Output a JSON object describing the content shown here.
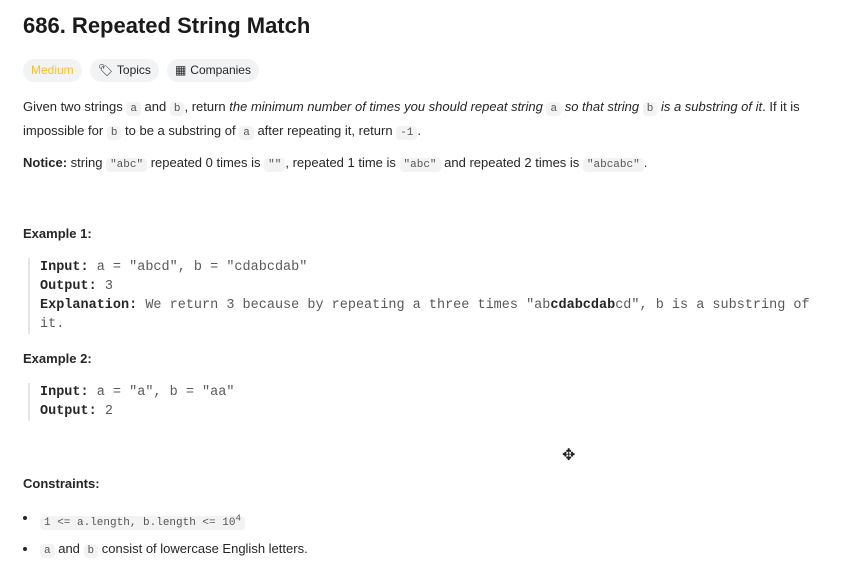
{
  "title": "686. Repeated String Match",
  "tags": {
    "difficulty": "Medium",
    "topics": "Topics",
    "companies": "Companies",
    "difficulty_color": "#ffc01e"
  },
  "desc": {
    "p1a": "Given two strings ",
    "a": "a",
    "and": " and ",
    "b": "b",
    "p1b": ", return ",
    "p1i": "the minimum number of times you should repeat string ",
    "p1j": " so that string ",
    "p1k": " is a substring of it",
    "p2a": ". If it is impossible for ",
    "p2b": " to be a substring of ",
    "p2c": " after repeating it, return ",
    "neg": "-1",
    "dot": "."
  },
  "notice": {
    "label": "Notice:",
    "t1": " string ",
    "c1": "\"abc\"",
    "t2": " repeated 0 times is ",
    "c2": "\"\"",
    "t3": ", repeated 1 time is ",
    "c3": "\"abc\"",
    "t4": " and repeated 2 times is ",
    "c4": "\"abcabc\"",
    "t5": "."
  },
  "example1": {
    "heading": "Example 1:",
    "input_label": "Input:",
    "input": " a = \"abcd\", b = \"cdabcdab\"",
    "output_label": "Output:",
    "output": " 3",
    "expl_label": "Explanation:",
    "expl_a": " We return 3 because by repeating a three times \"ab",
    "expl_b": "cdabcdab",
    "expl_c": "cd\", b is a substring of it."
  },
  "example2": {
    "heading": "Example 2:",
    "input_label": "Input:",
    "input": " a = \"a\", b = \"aa\"",
    "output_label": "Output:",
    "output": " 2"
  },
  "constraints": {
    "heading": "Constraints:",
    "c1": "1 <= a.length, b.length <= 10",
    "c1_sup": "4",
    "c2a": "a",
    "c2b": " and ",
    "c2c": "b",
    "c2d": " consist of lowercase English letters."
  }
}
